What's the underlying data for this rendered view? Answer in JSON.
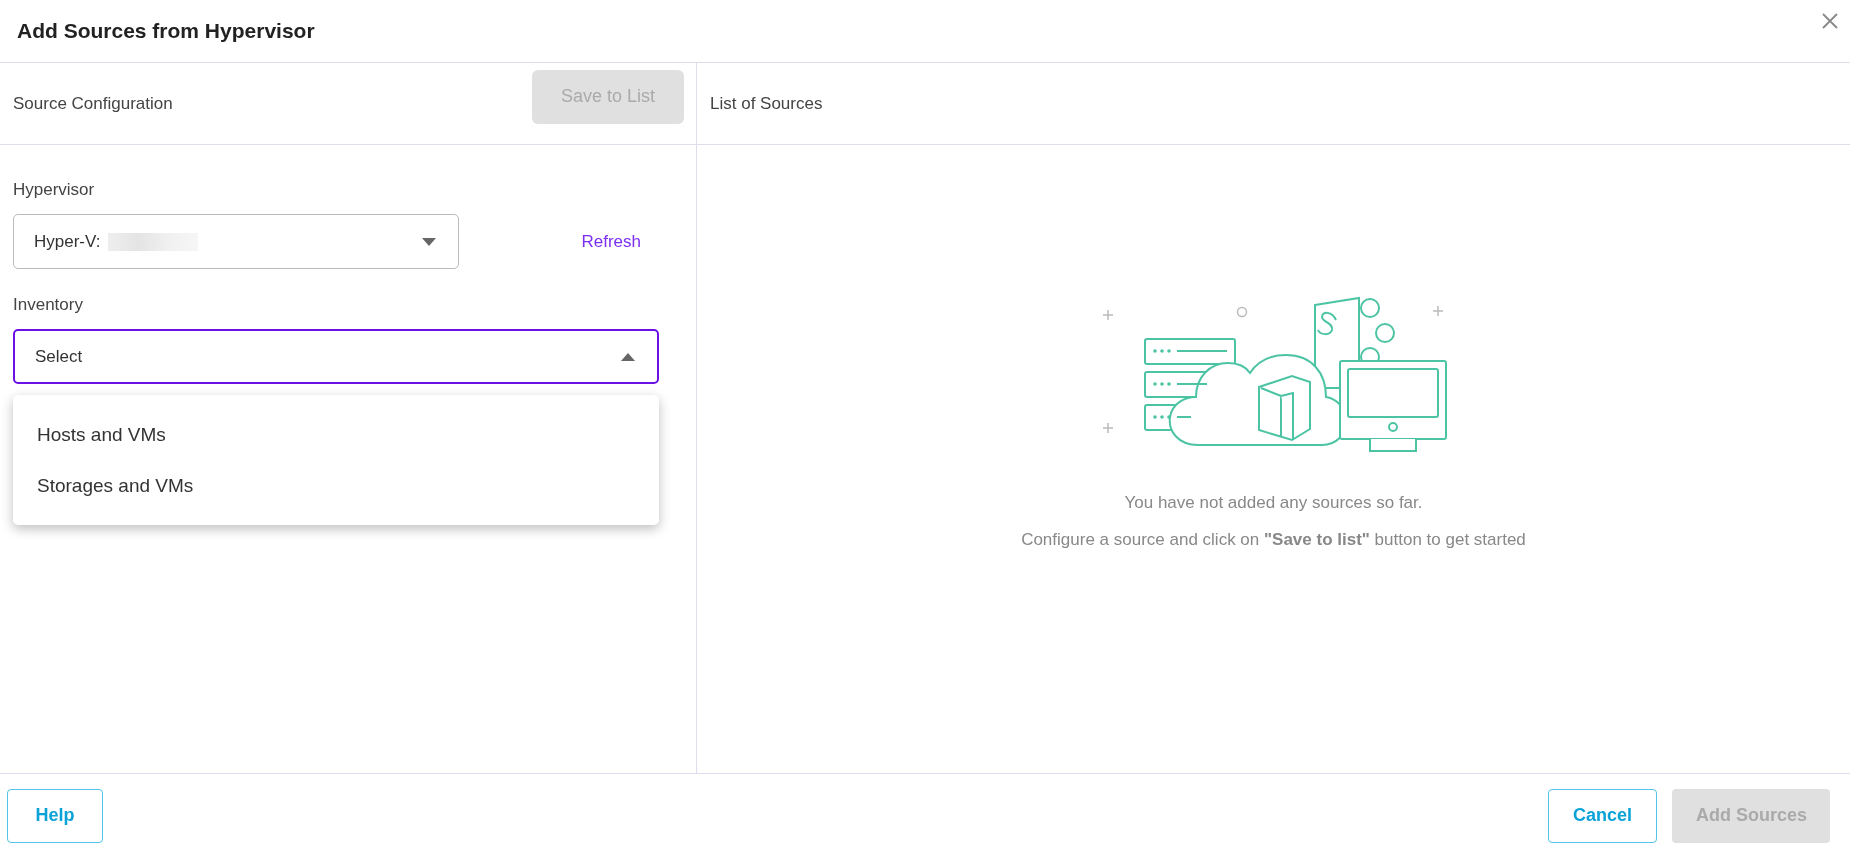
{
  "dialog": {
    "title": "Add Sources from Hypervisor"
  },
  "left_panel": {
    "title": "Source Configuration",
    "save_button": {
      "label": "Save to List",
      "disabled": true
    },
    "fields": [
      {
        "label": "Hypervisor",
        "value": "Hyper-V:",
        "redacted": true,
        "expanded": false,
        "link": "Refresh"
      },
      {
        "label": "Inventory",
        "placeholder": "Select",
        "expanded": true,
        "options": [
          "Hosts and VMs",
          "Storages and VMs"
        ]
      }
    ]
  },
  "right_panel": {
    "title": "List of Sources",
    "empty_message": "You have not added any sources so far.",
    "empty_hint": "Configure a source and click on **\"Save to list\"** button to get started"
  },
  "footer": {
    "buttons": [
      {
        "label": "Help",
        "kind": "outline",
        "disabled": false
      },
      {
        "label": "Cancel",
        "kind": "outline",
        "disabled": false
      },
      {
        "label": "Add Sources",
        "kind": "primary",
        "disabled": true
      }
    ]
  }
}
